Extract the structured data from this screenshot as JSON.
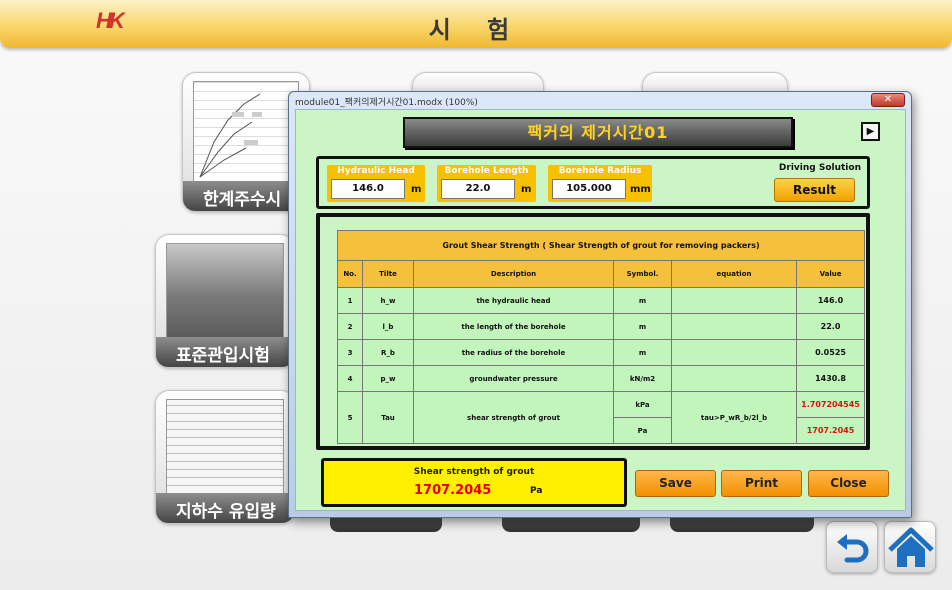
{
  "app": {
    "logo": "HK",
    "title": "시 험"
  },
  "tiles": [
    {
      "caption": "한계주수시"
    },
    {
      "caption": "표준관입시험"
    },
    {
      "caption": "지하수 유입량"
    }
  ],
  "dialog": {
    "window_title": "module01_팩커의제거시간01.modx (100%)",
    "close_glyph": "✕",
    "header": "팩커의 제거시간01",
    "play_glyph": "▶",
    "inputs": {
      "hydraulic_head": {
        "label": "Hydraulic Head",
        "value": "146.0",
        "unit": "m"
      },
      "borehole_length": {
        "label": "Borehole Length",
        "value": "22.0",
        "unit": "m"
      },
      "borehole_radius": {
        "label": "Borehole Radius",
        "value": "105.000",
        "unit": "mm"
      }
    },
    "driving_solution": "Driving Solution",
    "result_button": "Result",
    "table": {
      "title": "Grout Shear Strength ( Shear Strength of grout for removing packers)",
      "columns": [
        "No.",
        "Tilte",
        "Description",
        "Symbol.",
        "equation",
        "Value"
      ],
      "rows": [
        {
          "no": "1",
          "title": "h_w",
          "description": "the hydraulic head",
          "symbol": "m",
          "equation": "",
          "value": "146.0"
        },
        {
          "no": "2",
          "title": "l_b",
          "description": "the length of the borehole",
          "symbol": "m",
          "equation": "",
          "value": "22.0"
        },
        {
          "no": "3",
          "title": "R_b",
          "description": "the radius of the borehole",
          "symbol": "m",
          "equation": "",
          "value": "0.0525"
        },
        {
          "no": "4",
          "title": "p_w",
          "description": "groundwater pressure",
          "symbol": "kN/m2",
          "equation": "",
          "value": "1430.8"
        }
      ],
      "tau": {
        "no": "5",
        "title": "Tau",
        "description": "shear strength of grout",
        "symbol_1": "kPa",
        "symbol_2": "Pa",
        "equation": "tau>P_wR_b/2l_b",
        "value_1": "1.707204545",
        "value_2": "1707.2045"
      }
    },
    "shear_result": {
      "label": "Shear strength of grout",
      "value": "1707.2045",
      "unit": "Pa"
    },
    "buttons": {
      "save": "Save",
      "print": "Print",
      "close": "Close"
    }
  },
  "nav": {
    "back_icon": "back-arrow-icon",
    "home_icon": "home-icon"
  },
  "colors": {
    "accent": "#f7c000",
    "panel": "#ccf5c6",
    "result": "#ffef00",
    "highlight": "#e60000"
  }
}
